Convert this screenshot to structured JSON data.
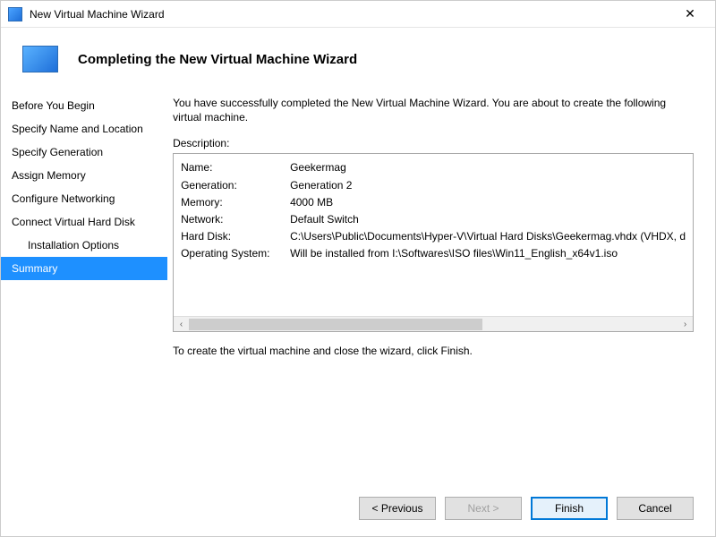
{
  "window": {
    "title": "New Virtual Machine Wizard"
  },
  "header": {
    "title": "Completing the New Virtual Machine Wizard"
  },
  "sidebar": {
    "items": [
      {
        "label": "Before You Begin",
        "indent": false,
        "selected": false
      },
      {
        "label": "Specify Name and Location",
        "indent": false,
        "selected": false
      },
      {
        "label": "Specify Generation",
        "indent": false,
        "selected": false
      },
      {
        "label": "Assign Memory",
        "indent": false,
        "selected": false
      },
      {
        "label": "Configure Networking",
        "indent": false,
        "selected": false
      },
      {
        "label": "Connect Virtual Hard Disk",
        "indent": false,
        "selected": false
      },
      {
        "label": "Installation Options",
        "indent": true,
        "selected": false
      },
      {
        "label": "Summary",
        "indent": false,
        "selected": true
      }
    ]
  },
  "content": {
    "intro": "You have successfully completed the New Virtual Machine Wizard. You are about to create the following virtual machine.",
    "description_label": "Description:",
    "rows": [
      {
        "key": "Name:",
        "value": "Geekermag"
      },
      {
        "key": "Generation:",
        "value": "Generation 2"
      },
      {
        "key": "Memory:",
        "value": "4000 MB"
      },
      {
        "key": "Network:",
        "value": "Default Switch"
      },
      {
        "key": "Hard Disk:",
        "value": "C:\\Users\\Public\\Documents\\Hyper-V\\Virtual Hard Disks\\Geekermag.vhdx (VHDX, d"
      },
      {
        "key": "Operating System:",
        "value": "Will be installed from I:\\Softwares\\ISO files\\Win11_English_x64v1.iso"
      }
    ],
    "finish_hint": "To create the virtual machine and close the wizard, click Finish."
  },
  "footer": {
    "previous": "< Previous",
    "next": "Next >",
    "finish": "Finish",
    "cancel": "Cancel"
  }
}
